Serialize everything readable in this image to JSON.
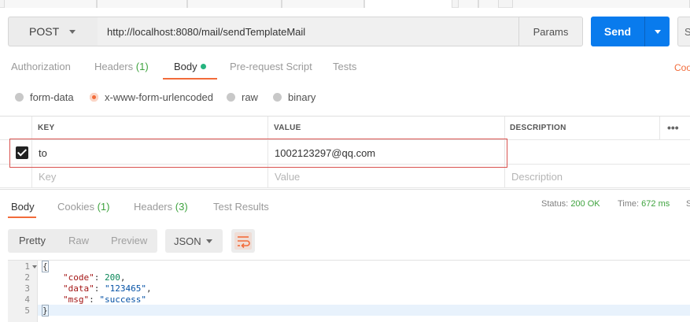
{
  "request": {
    "method": "POST",
    "url": "http://localhost:8080/mail/sendTemplateMail",
    "params_label": "Params",
    "send_label": "Send",
    "save_label": "S"
  },
  "request_tabs": {
    "authorization": "Authorization",
    "headers": "Headers",
    "headers_count": "(1)",
    "body": "Body",
    "pre_request": "Pre-request Script",
    "tests": "Tests",
    "code_link": "Coo"
  },
  "body_types": {
    "form_data": "form-data",
    "urlencoded": "x-www-form-urlencoded",
    "raw": "raw",
    "binary": "binary",
    "selected": "x-www-form-urlencoded"
  },
  "table": {
    "headers": {
      "key": "KEY",
      "value": "VALUE",
      "description": "DESCRIPTION",
      "more": "•••"
    },
    "rows": [
      {
        "checked": true,
        "key": "to",
        "value": "1002123297@qq.com",
        "description": ""
      }
    ],
    "placeholders": {
      "key": "Key",
      "value": "Value",
      "description": "Description"
    }
  },
  "response_tabs": {
    "body": "Body",
    "cookies": "Cookies",
    "cookies_count": "(1)",
    "headers": "Headers",
    "headers_count": "(3)",
    "test_results": "Test Results"
  },
  "status": {
    "status_label": "Status:",
    "status_value": "200 OK",
    "time_label": "Time:",
    "time_value": "672 ms",
    "size_label": "S"
  },
  "view": {
    "pretty": "Pretty",
    "raw": "Raw",
    "preview": "Preview",
    "format": "JSON"
  },
  "code": {
    "line_numbers": [
      "1",
      "2",
      "3",
      "4",
      "5"
    ],
    "lines": {
      "l1": "{",
      "l2_key": "\"code\"",
      "l2_sep": ": ",
      "l2_val": "200",
      "l2_end": ",",
      "l3_key": "\"data\"",
      "l3_sep": ": ",
      "l3_val": "\"123465\"",
      "l3_end": ",",
      "l4_key": "\"msg\"",
      "l4_sep": ": ",
      "l4_val": "\"success\"",
      "l5": "}"
    }
  },
  "colors": {
    "send_blue": "#097bed",
    "accent_orange": "#f26b3a",
    "status_green": "#3fa33f",
    "highlight_red": "#d9534f"
  }
}
